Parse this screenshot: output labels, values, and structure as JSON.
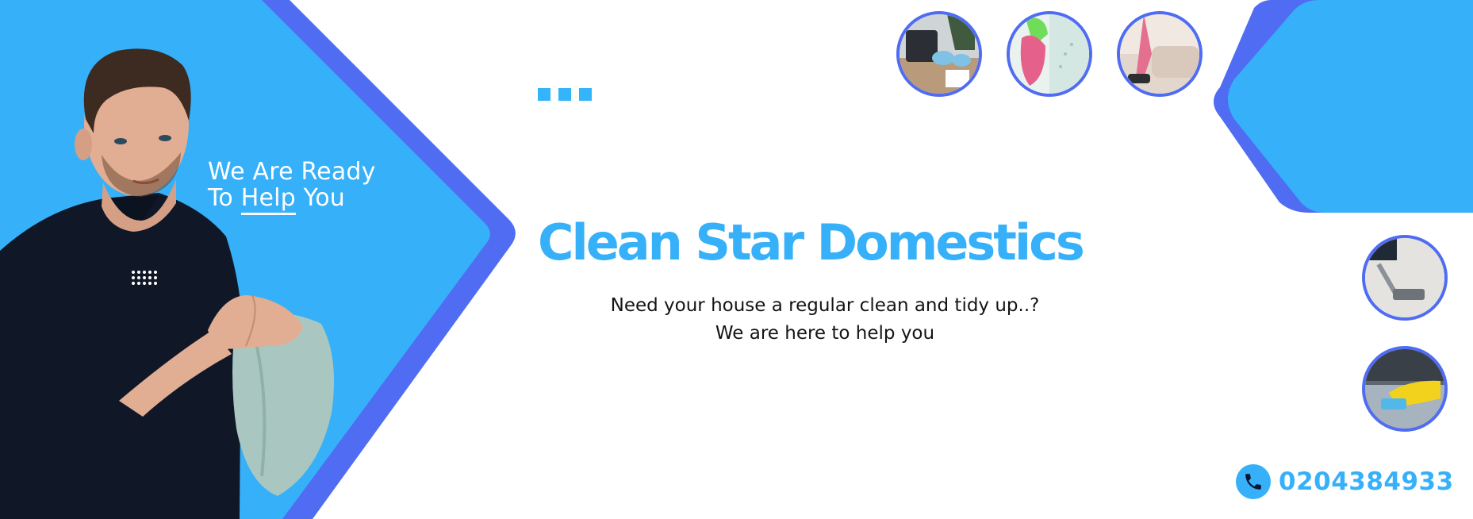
{
  "tagline": {
    "line1": "We Are Ready",
    "line2_prefix": "To ",
    "line2_highlight": "Help",
    "line2_suffix": " You"
  },
  "brand": {
    "name": "Clean Star Domestics"
  },
  "subtitle": {
    "line1": "Need your house a regular clean and tidy up..?",
    "line2": "We are here to help you"
  },
  "contact": {
    "phone": "0204384933"
  },
  "photos": [
    "desk-cleaning-photo",
    "window-cleaning-photo",
    "sofa-vacuum-photo",
    "carpet-cleaning-photo",
    "surface-wiping-photo"
  ],
  "colors": {
    "brand_blue": "#36b0f9",
    "accent_indigo": "#4f6cf3",
    "shirt_navy": "#101828",
    "text": "#141414"
  }
}
